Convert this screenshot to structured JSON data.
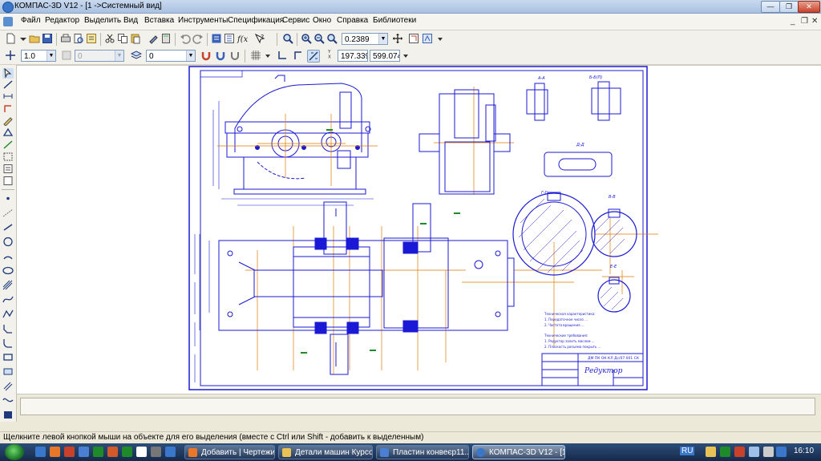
{
  "window": {
    "title": "КОМПАС-3D V12 - [1 ->Системный вид]",
    "min_label": "—",
    "max_label": "❐",
    "close_label": "✕"
  },
  "menubar": {
    "items": [
      "Файл",
      "Редактор",
      "Выделить",
      "Вид",
      "Вставка",
      "Инструменты",
      "Спецификация",
      "Сервис",
      "Окно",
      "Справка",
      "Библиотеки"
    ],
    "mdi": {
      "min": "_",
      "restore": "❐",
      "close": "✕"
    }
  },
  "toolbar_standard": {
    "zoom_value": "0.2389"
  },
  "toolbar_current_state": {
    "line_step": "1.0",
    "layer_disabled": "0",
    "layer": "0",
    "coord_x": "197.339",
    "coord_y": "599.074",
    "coord_label": "Y\nX"
  },
  "drawing": {
    "title_block_name": "Редуктор",
    "stamp_code": "ДМ ПК ОК КЛ Дс/07.001 СК",
    "section_labels": [
      "А-А",
      "Б-Б(П)",
      "Д-Д",
      "Г-Г",
      "В-В",
      "Е-Е"
    ],
    "tech_notes": [
      "Техническая характеристика:",
      "1. Передаточное число ...",
      "2. Частота вращения ...",
      "Технические требования:",
      "1. Редуктор залить маслом ...",
      "2. Плоскость разъема покрыть ..."
    ],
    "colors": {
      "line": "#1a1ad6",
      "axis": "#e07a00",
      "border": "#1a1ad6",
      "hatch": "#1a1ad6",
      "dim": "#1a1ad6"
    }
  },
  "statusbar": {
    "hint": "Щелкните левой кнопкой мыши на объекте для его выделения (вместе с Ctrl или Shift - добавить к выделенным)"
  },
  "taskbar": {
    "tasks": [
      {
        "label": "Добавить | Чертежи ...",
        "icon": "firefox-icon",
        "color": "#e8772a"
      },
      {
        "label": "Детали машин Курсові",
        "icon": "folder-icon",
        "color": "#e8c255"
      },
      {
        "label": "Пластин конвеєр11....",
        "icon": "document-icon",
        "color": "#4a7fd1"
      },
      {
        "label": "КОМПАС-3D V12 - [1 ...",
        "icon": "kompas-icon",
        "color": "#3a76c9"
      }
    ],
    "lang": "RU",
    "time": "16:10"
  }
}
